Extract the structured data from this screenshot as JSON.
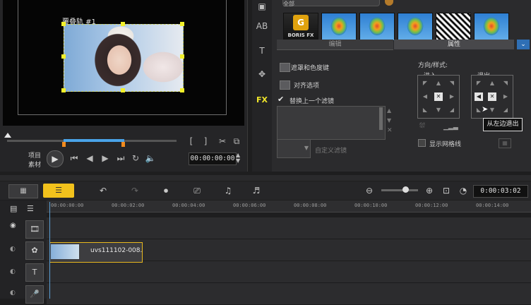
{
  "preview": {
    "overlay_label": "覆叠轨 #1",
    "mode_project": "项目",
    "mode_clip": "素材",
    "timecode": "00:00:00:00"
  },
  "right_panel": {
    "category_value": "全部",
    "effect_thumbs": [
      {
        "name": "boris-fx",
        "caption": "BORIS FX",
        "logo": "G"
      },
      {
        "name": "balloon-1"
      },
      {
        "name": "balloon-2"
      },
      {
        "name": "balloon-3"
      },
      {
        "name": "silhouette"
      },
      {
        "name": "balloon-4"
      }
    ],
    "tabs": {
      "edit": "编辑",
      "attributes": "属性"
    },
    "options": {
      "mask_chroma": "遮罩和色度键",
      "align_options": "对齐选项",
      "replace_last_filter": "替换上一个滤镜",
      "custom_filter": "自定义滤镜"
    },
    "direction": {
      "title": "方向/样式:",
      "enter": "进入",
      "exit": "退出",
      "tooltip": "从左边退出"
    },
    "show_grid": "显示网格线"
  },
  "timeline": {
    "duration": "0:00:03:02",
    "ruler_ticks": [
      "00:00:00:00",
      "00:00:02:00",
      "00:00:04:00",
      "00:00:06:00",
      "00:00:08:00",
      "00:00:10:00",
      "00:00:12:00",
      "00:00:14:00"
    ],
    "clip_name": "uvs111102-008."
  },
  "colors": {
    "accent_yellow": "#f2c21c",
    "selection_handles": "#f2f02a",
    "trim_blue": "#4aa3e8",
    "trim_orange": "#f08a1e"
  }
}
